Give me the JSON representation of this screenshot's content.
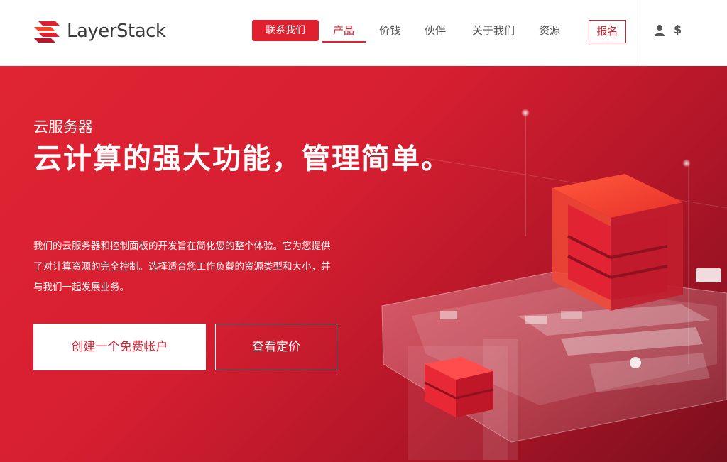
{
  "brand": {
    "name": "LayerStack",
    "accent": "#e0202f"
  },
  "nav": {
    "contact": "联系我们",
    "products": "产品",
    "price": "价钱",
    "partner": "伙伴",
    "about": "关于我们",
    "resources": "资源",
    "signup": "报名",
    "currency": "$",
    "user_icon": "user-icon"
  },
  "hero": {
    "eyebrow": "云服务器",
    "headline": "云计算的强大功能，管理简单。",
    "description": "我们的云服务器和控制面板的开发旨在简化您的整个体验。它为您提供了对计算资源的完全控制。选择适合您工作负载的资源类型和大小，并与我们一起发展业务。",
    "primary_button": "创建一个免费帐户",
    "secondary_button": "查看定价"
  }
}
